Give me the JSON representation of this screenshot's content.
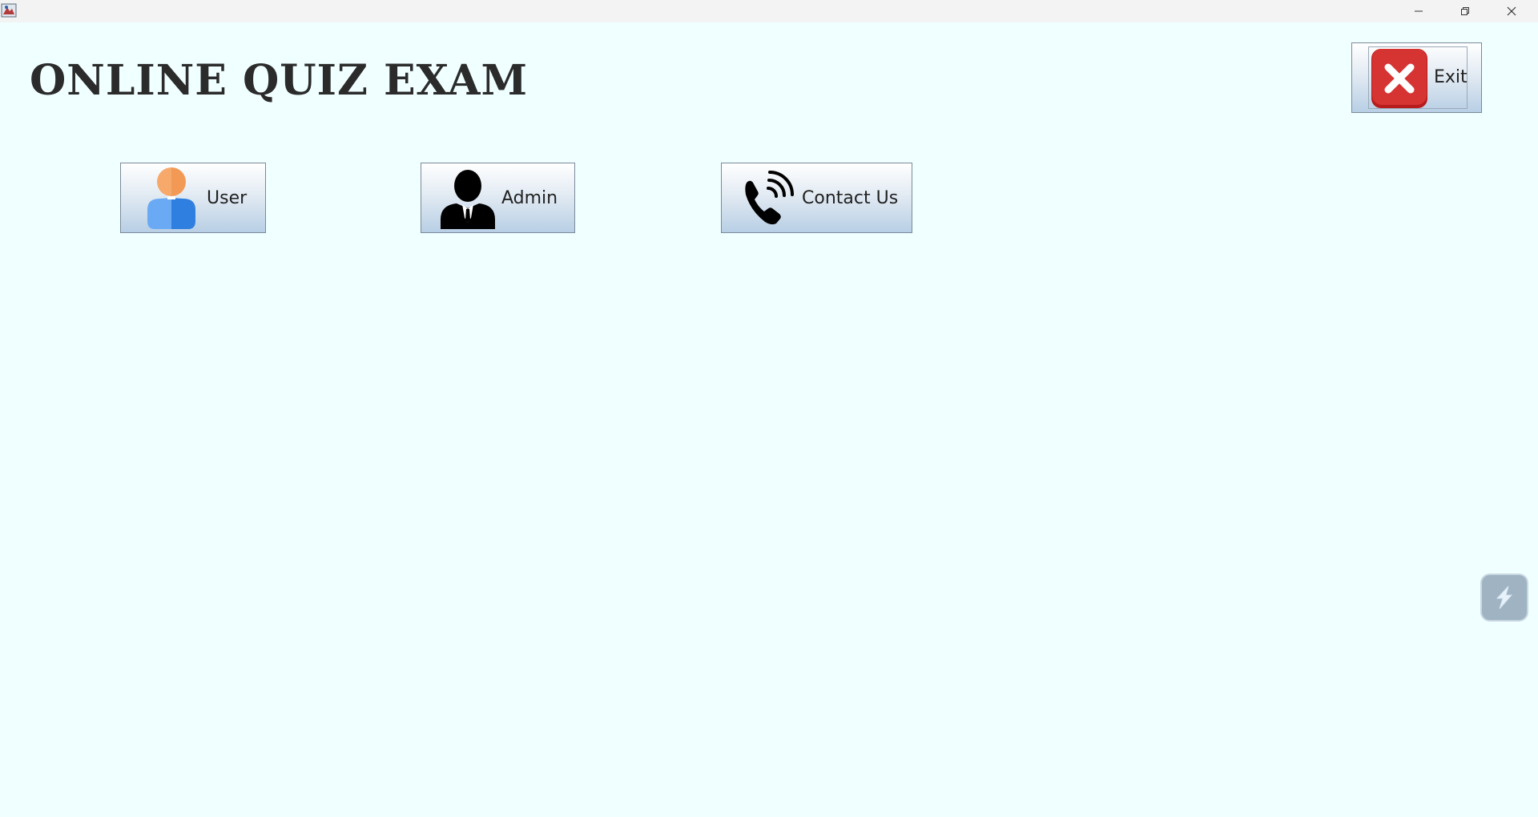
{
  "window": {
    "minimize_glyph": "–",
    "restore_glyph": "❐",
    "close_glyph": "✕"
  },
  "page": {
    "title": "ONLINE QUIZ EXAM"
  },
  "buttons": {
    "user": {
      "label": "User",
      "icon": "user-icon"
    },
    "admin": {
      "label": "Admin",
      "icon": "admin-icon"
    },
    "contact": {
      "label": "Contact Us",
      "icon": "phone-icon"
    },
    "exit": {
      "label": "Exit",
      "icon": "close-x-icon"
    }
  },
  "colors": {
    "background": "#f0ffff",
    "exit_icon_red": "#d32f2f",
    "user_head": "#f7a96b",
    "user_body": "#4a90e2"
  }
}
